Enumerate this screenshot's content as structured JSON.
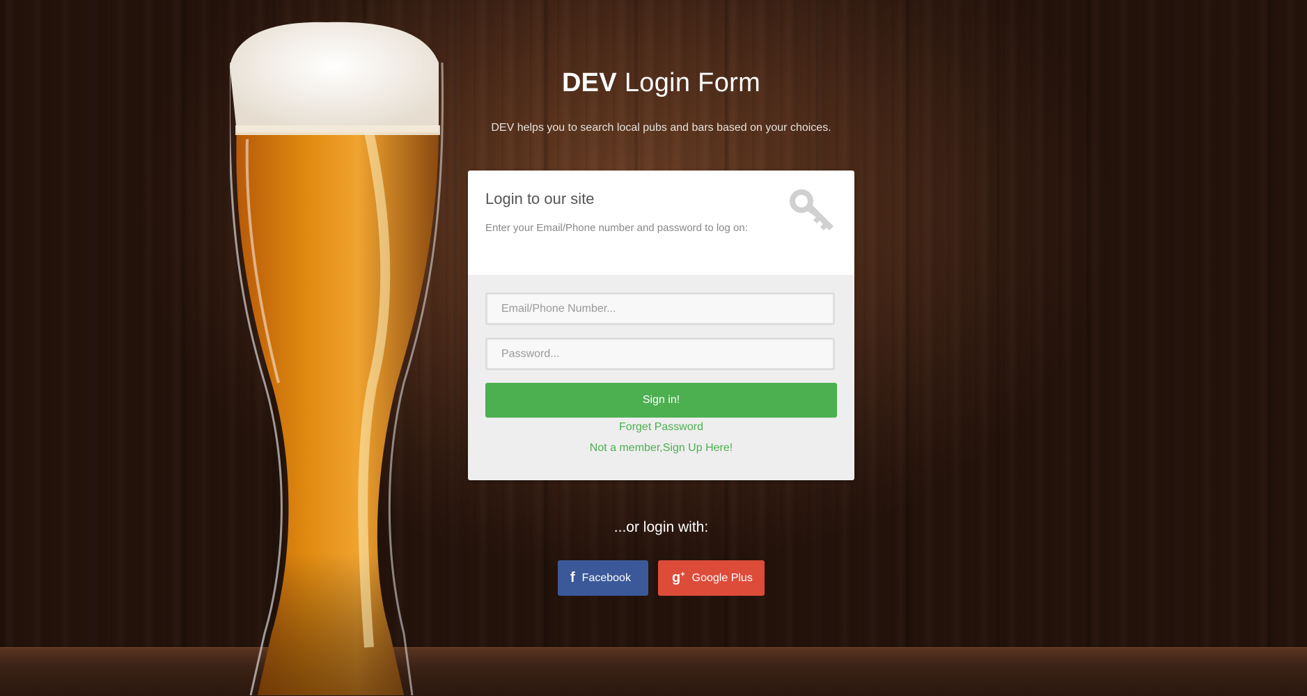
{
  "header": {
    "brand": "DEV",
    "title_rest": "Login Form",
    "subtitle": "DEV helps you to search local pubs and bars based on your choices."
  },
  "login_card": {
    "heading": "Login to our site",
    "description": "Enter your Email/Phone number and password to log on:",
    "email_placeholder": "Email/Phone Number...",
    "password_placeholder": "Password...",
    "signin_label": "Sign in!",
    "forgot_label": "Forget Password",
    "signup_label": "Not a member,Sign Up Here!"
  },
  "social": {
    "prompt": "...or login with:",
    "facebook_label": "Facebook",
    "google_label": "Google Plus"
  },
  "colors": {
    "accent_green": "#4caf50",
    "facebook_blue": "#3b5998",
    "google_red": "#dd4b39"
  }
}
